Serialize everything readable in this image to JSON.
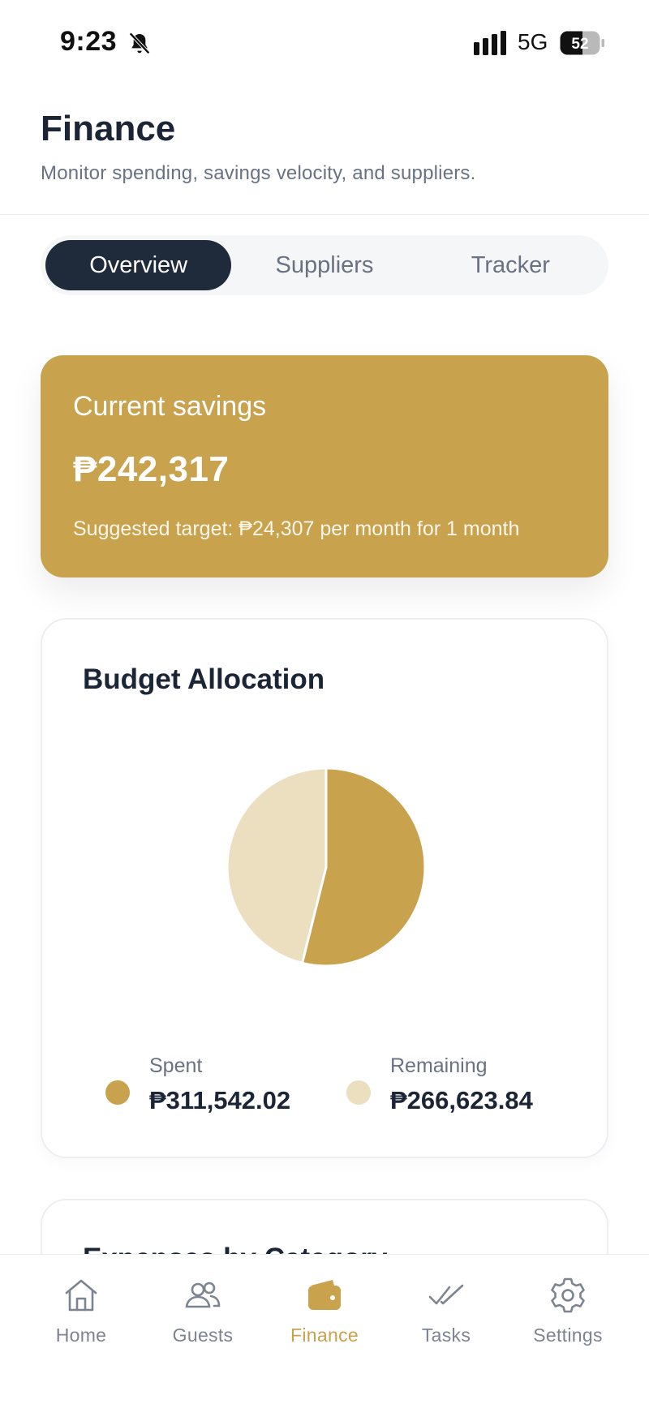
{
  "status_bar": {
    "time": "9:23",
    "network": "5G",
    "battery": "52"
  },
  "header": {
    "title": "Finance",
    "subtitle": "Monitor spending, savings velocity, and suppliers."
  },
  "tabs": [
    {
      "label": "Overview",
      "active": true
    },
    {
      "label": "Suppliers",
      "active": false
    },
    {
      "label": "Tracker",
      "active": false
    }
  ],
  "savings": {
    "label": "Current savings",
    "amount": "₱242,317",
    "note": "Suggested target: ₱24,307 per month for 1 month"
  },
  "budget": {
    "title": "Budget Allocation",
    "legend": [
      {
        "label": "Spent",
        "value": "₱311,542.02",
        "color": "#c8a24c"
      },
      {
        "label": "Remaining",
        "value": "₱266,623.84",
        "color": "#ebdfc0"
      }
    ]
  },
  "chart_data": {
    "type": "pie",
    "title": "Budget Allocation",
    "categories": [
      "Spent",
      "Remaining"
    ],
    "values": [
      311542.02,
      266623.84
    ],
    "colors": [
      "#c8a24c",
      "#ebdfc0"
    ]
  },
  "next_card": {
    "title": "Expenses by Category"
  },
  "colors": {
    "accent": "#c8a24c",
    "dark": "#1f2a3a",
    "muted": "#687283"
  },
  "nav": [
    {
      "label": "Home",
      "icon": "home-icon",
      "active": false
    },
    {
      "label": "Guests",
      "icon": "users-icon",
      "active": false
    },
    {
      "label": "Finance",
      "icon": "wallet-icon",
      "active": true
    },
    {
      "label": "Tasks",
      "icon": "double-check-icon",
      "active": false
    },
    {
      "label": "Settings",
      "icon": "gear-icon",
      "active": false
    }
  ]
}
